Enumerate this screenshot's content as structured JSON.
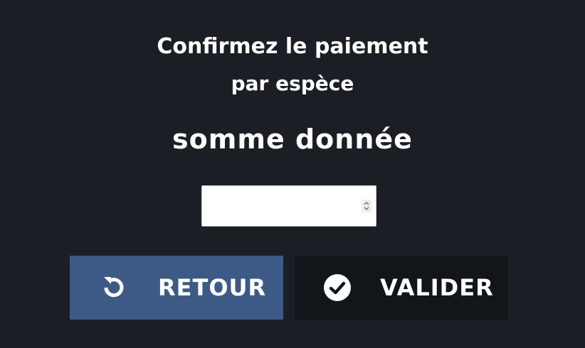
{
  "dialog": {
    "title_line1": "Confirmez le paiement",
    "title_line2": "par espèce",
    "amount_label": "somme donnée",
    "amount_value": "",
    "amount_placeholder": ""
  },
  "buttons": {
    "back": {
      "label": "RETOUR",
      "icon": "undo-icon",
      "color": "#3d5a86"
    },
    "validate": {
      "label": "VALIDER",
      "icon": "check-circle-icon",
      "color": "#12151a"
    }
  },
  "colors": {
    "background": "#1b1f25",
    "text": "#ffffff"
  }
}
